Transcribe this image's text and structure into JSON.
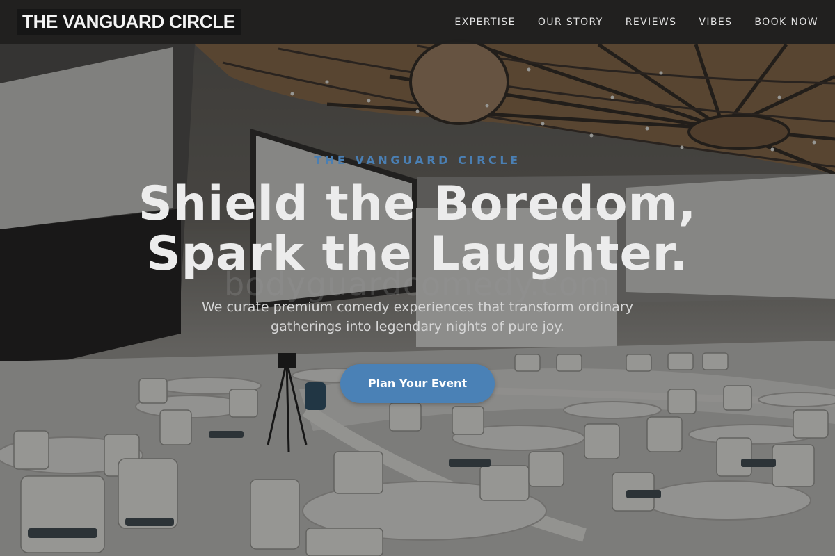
{
  "nav": {
    "brand": "THE VANGUARD CIRCLE",
    "links": [
      {
        "label": "EXPERTISE"
      },
      {
        "label": "OUR STORY"
      },
      {
        "label": "REVIEWS"
      },
      {
        "label": "VIBES"
      },
      {
        "label": "BOOK NOW"
      }
    ]
  },
  "hero": {
    "eyebrow": "THE VANGUARD CIRCLE",
    "headline_line1": "Shield the Boredom,",
    "headline_line2": "Spark the Laughter.",
    "watermark": "bodyguardcomedy.com",
    "subtext": "We curate premium comedy experiences that transform ordinary gatherings into legendary nights of pure joy.",
    "cta_label": "Plan Your Event"
  },
  "colors": {
    "accent": "#4a81b6",
    "eyebrow": "#4a7fb3",
    "navbar_bg": "#201f1e"
  },
  "background": {
    "scene": "conference hall with round tables, white chairs, projection screens and wooden radial ceiling"
  }
}
